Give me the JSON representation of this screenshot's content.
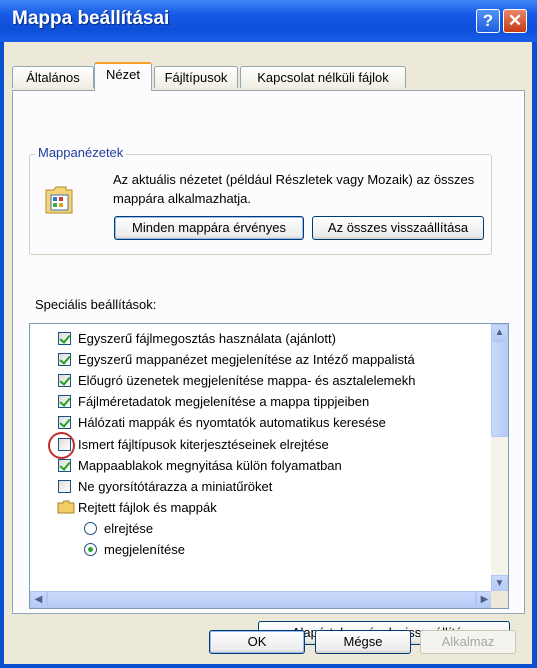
{
  "window": {
    "title": "Mappa beállításai"
  },
  "titlebar": {
    "help_glyph": "?",
    "close_glyph": "✕"
  },
  "tabs": [
    {
      "label": "Általános"
    },
    {
      "label": "Nézet",
      "active": true
    },
    {
      "label": "Fájltípusok"
    },
    {
      "label": "Kapcsolat nélküli fájlok"
    }
  ],
  "folder_views": {
    "group_title": "Mappanézetek",
    "description": "Az aktuális nézetet (például Részletek vagy Mozaik) az összes mappára alkalmazhatja.",
    "apply_button": "Minden mappára érvényes",
    "reset_button": "Az összes visszaállítása"
  },
  "advanced": {
    "label": "Speciális beállítások:",
    "items": [
      {
        "type": "checkbox",
        "checked": true,
        "label": "Egyszerű fájlmegosztás használata (ajánlott)"
      },
      {
        "type": "checkbox",
        "checked": true,
        "label": "Egyszerű mappanézet megjelenítése az Intéző mappalistá"
      },
      {
        "type": "checkbox",
        "checked": true,
        "label": "Előugró üzenetek megjelenítése mappa- és asztalelemekh"
      },
      {
        "type": "checkbox",
        "checked": true,
        "label": "Fájlméretadatok megjelenítése a mappa tippjeiben"
      },
      {
        "type": "checkbox",
        "checked": true,
        "label": "Hálózati mappák és nyomtatók automatikus keresése"
      },
      {
        "type": "checkbox",
        "checked": false,
        "label": "Ismert fájltípusok kiterjesztéseinek elrejtése",
        "highlighted": true
      },
      {
        "type": "checkbox",
        "checked": true,
        "label": "Mappaablakok megnyitása külön folyamatban"
      },
      {
        "type": "checkbox",
        "checked": false,
        "label": "Ne gyorsítótárazza a miniatűröket"
      },
      {
        "type": "folder",
        "label": "Rejtett fájlok és mappák"
      },
      {
        "type": "radio",
        "checked": false,
        "label": "elrejtése"
      },
      {
        "type": "radio",
        "checked": true,
        "label": "megjelenítése"
      }
    ],
    "restore_defaults_button": "Alapértelmezések visszaállítása"
  },
  "footer": {
    "ok": "OK",
    "cancel": "Mégse",
    "apply": "Alkalmaz"
  },
  "colors": {
    "title_bar": "#1759e6",
    "dialog_face": "#ece9d8",
    "highlight_ring": "#c42c2c"
  }
}
